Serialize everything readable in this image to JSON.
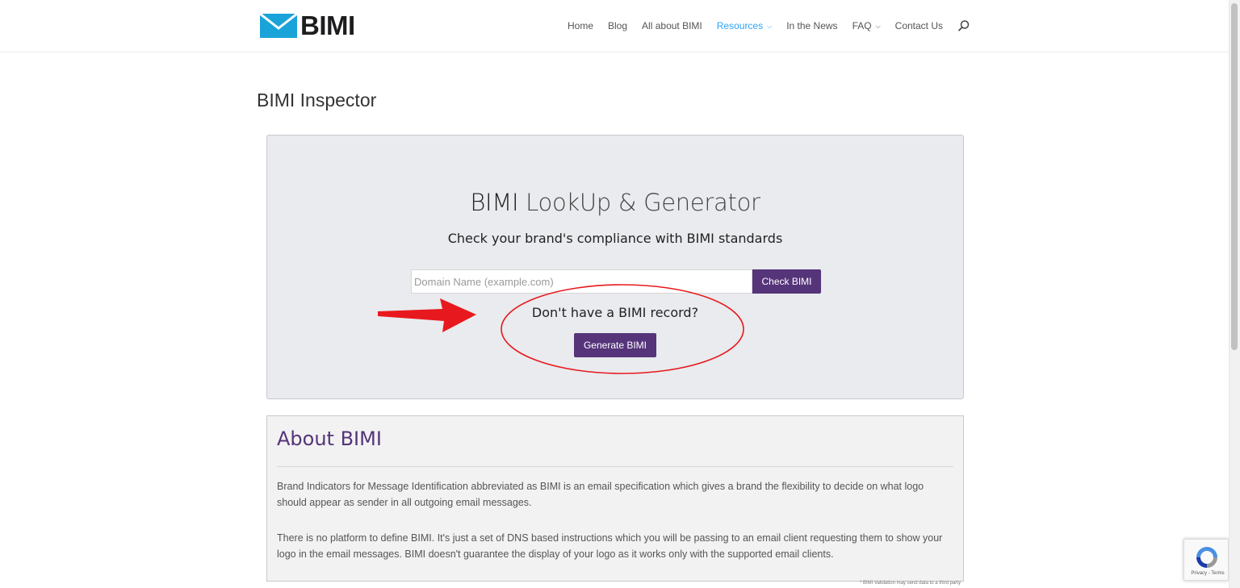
{
  "header": {
    "logo_text": "BIMI",
    "nav": [
      {
        "label": "Home",
        "dropdown": false,
        "active": false
      },
      {
        "label": "Blog",
        "dropdown": false,
        "active": false
      },
      {
        "label": "All about BIMI",
        "dropdown": false,
        "active": false
      },
      {
        "label": "Resources",
        "dropdown": true,
        "active": true
      },
      {
        "label": "In the News",
        "dropdown": false,
        "active": false
      },
      {
        "label": "FAQ",
        "dropdown": true,
        "active": false
      },
      {
        "label": "Contact Us",
        "dropdown": false,
        "active": false
      }
    ],
    "accent_color": "#2ea3f2"
  },
  "page_title": "BIMI Inspector",
  "lookup": {
    "title_strong": "BIMI",
    "title_rest": " LookUp & Generator",
    "subtitle": "Check your brand's compliance with BIMI standards",
    "input_placeholder": "Domain Name (example.com)",
    "input_value": "",
    "check_button": "Check BIMI",
    "no_record_text": "Don't have a BIMI record?",
    "generate_button": "Generate BIMI",
    "button_color": "#55347a"
  },
  "about": {
    "title": "About BIMI",
    "paragraph1": "Brand Indicators for Message Identification abbreviated as BIMI is an email specification which gives a brand the flexibility to decide on what logo should appear as sender in all outgoing email messages.",
    "paragraph2": "There is no platform to define BIMI. It's just a set of DNS based instructions which you will be passing to an email client requesting them to show your logo in the email messages. BIMI doesn't guarantee the display of your logo as it works only with the supported email clients."
  },
  "footnote": "* BIMI Validation may send data to a third party",
  "recaptcha": {
    "links": "Privacy - Terms"
  },
  "annotation_color": "#e8191e"
}
